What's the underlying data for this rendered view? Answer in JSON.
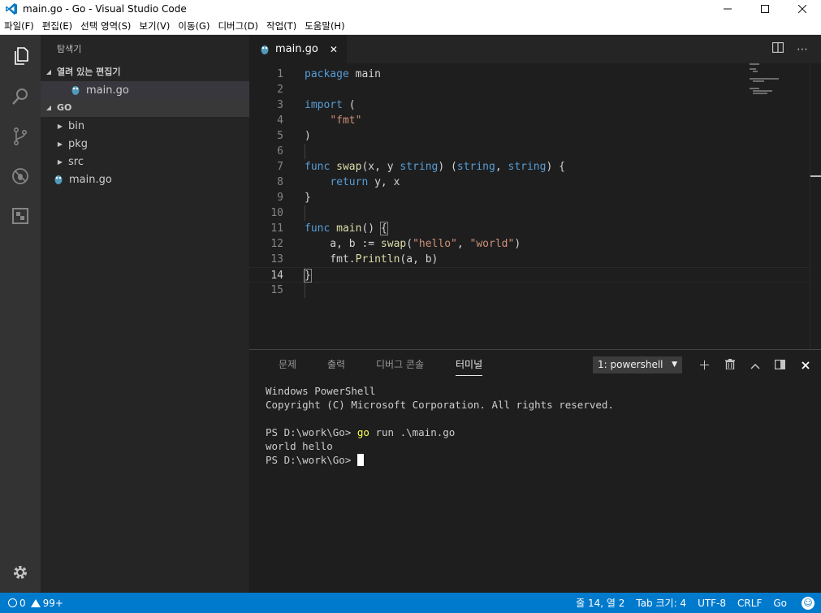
{
  "window": {
    "title": "main.go - Go - Visual Studio Code"
  },
  "menu": [
    "파일(F)",
    "편집(E)",
    "선택 영역(S)",
    "보기(V)",
    "이동(G)",
    "디버그(D)",
    "작업(T)",
    "도움말(H)"
  ],
  "sidebar": {
    "title": "탐색기",
    "open_editors": {
      "label": "열려 있는 편집기",
      "items": [
        "main.go"
      ]
    },
    "folder": {
      "label": "GO",
      "items": [
        {
          "label": "bin",
          "kind": "folder"
        },
        {
          "label": "pkg",
          "kind": "folder"
        },
        {
          "label": "src",
          "kind": "folder"
        },
        {
          "label": "main.go",
          "kind": "file"
        }
      ]
    }
  },
  "editor": {
    "tab_label": "main.go",
    "line_numbers": [
      "1",
      "2",
      "3",
      "4",
      "5",
      "6",
      "7",
      "8",
      "9",
      "10",
      "11",
      "12",
      "13",
      "14",
      "15"
    ],
    "current_line": 14
  },
  "panel": {
    "tabs": [
      "문제",
      "출력",
      "디버그 콘솔",
      "터미널"
    ],
    "active_tab": "터미널",
    "terminal_select": "1: powershell",
    "terminal": {
      "line1": "Windows PowerShell",
      "line2": "Copyright (C) Microsoft Corporation. All rights reserved.",
      "prompt1": "PS D:\\work\\Go> ",
      "command": "go",
      "args": " run .\\main.go",
      "output": "world hello",
      "prompt2": "PS D:\\work\\Go> "
    }
  },
  "statusbar": {
    "errors": "0",
    "warnings": "99+",
    "position": "줄 14, 열 2",
    "tab_size": "Tab 크기: 4",
    "encoding": "UTF-8",
    "eol": "CRLF",
    "language": "Go"
  },
  "colors": {
    "accent": "#007acc",
    "keyword": "#569cd6",
    "function": "#dcdcaa",
    "string": "#ce9178"
  }
}
